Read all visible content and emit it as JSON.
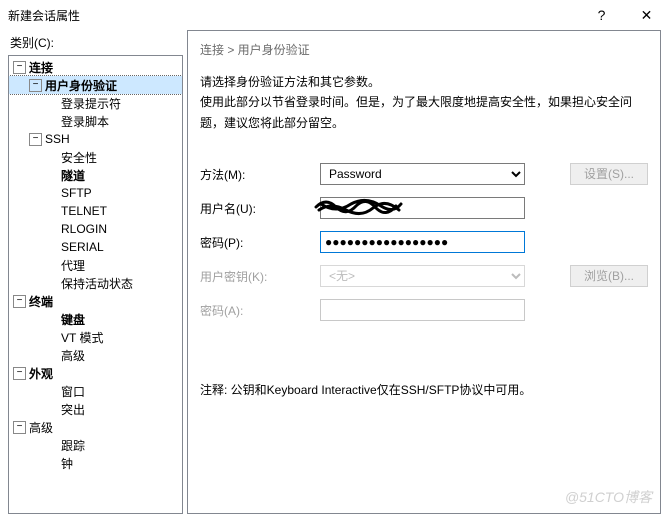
{
  "window": {
    "title": "新建会话属性",
    "help": "?",
    "close": "✕"
  },
  "sidebar": {
    "label": "类别(C):",
    "nodes": [
      {
        "pad": 4,
        "tw": "−",
        "label": "连接",
        "bold": true
      },
      {
        "pad": 20,
        "tw": "−",
        "label": "用户身份验证",
        "bold": true,
        "sel": true
      },
      {
        "pad": 36,
        "tw": "",
        "label": "登录提示符"
      },
      {
        "pad": 36,
        "tw": "",
        "label": "登录脚本"
      },
      {
        "pad": 20,
        "tw": "−",
        "label": "SSH"
      },
      {
        "pad": 36,
        "tw": "",
        "label": "安全性"
      },
      {
        "pad": 36,
        "tw": "",
        "label": "隧道",
        "bold": true
      },
      {
        "pad": 36,
        "tw": "",
        "label": "SFTP"
      },
      {
        "pad": 36,
        "tw": "",
        "label": "TELNET"
      },
      {
        "pad": 36,
        "tw": "",
        "label": "RLOGIN"
      },
      {
        "pad": 36,
        "tw": "",
        "label": "SERIAL"
      },
      {
        "pad": 36,
        "tw": "",
        "label": "代理"
      },
      {
        "pad": 36,
        "tw": "",
        "label": "保持活动状态"
      },
      {
        "pad": 4,
        "tw": "−",
        "label": "终端",
        "bold": true
      },
      {
        "pad": 36,
        "tw": "",
        "label": "键盘",
        "bold": true
      },
      {
        "pad": 36,
        "tw": "",
        "label": "VT 模式"
      },
      {
        "pad": 36,
        "tw": "",
        "label": "高级"
      },
      {
        "pad": 4,
        "tw": "−",
        "label": "外观",
        "bold": true
      },
      {
        "pad": 36,
        "tw": "",
        "label": "窗口"
      },
      {
        "pad": 36,
        "tw": "",
        "label": "突出"
      },
      {
        "pad": 4,
        "tw": "−",
        "label": "高级"
      },
      {
        "pad": 36,
        "tw": "",
        "label": "跟踪"
      },
      {
        "pad": 36,
        "tw": "",
        "label": "钟"
      }
    ]
  },
  "main": {
    "crumb": "连接 > 用户身份验证",
    "desc1": "请选择身份验证方法和其它参数。",
    "desc2": "使用此部分以节省登录时间。但是，为了最大限度地提高安全性，如果担心安全问题，建议您将此部分留空。",
    "method_label": "方法(M):",
    "method_value": "Password",
    "settings_btn": "设置(S)...",
    "user_label": "用户名(U):",
    "pass_label": "密码(P):",
    "pass_value": "●●●●●●●●●●●●●●●●●",
    "key_label": "用户密钥(K):",
    "key_value": "<无>",
    "browse_btn": "浏览(B)...",
    "pass2_label": "密码(A):",
    "note": "注释: 公钥和Keyboard Interactive仅在SSH/SFTP协议中可用。"
  },
  "watermark": "@51CTO博客"
}
